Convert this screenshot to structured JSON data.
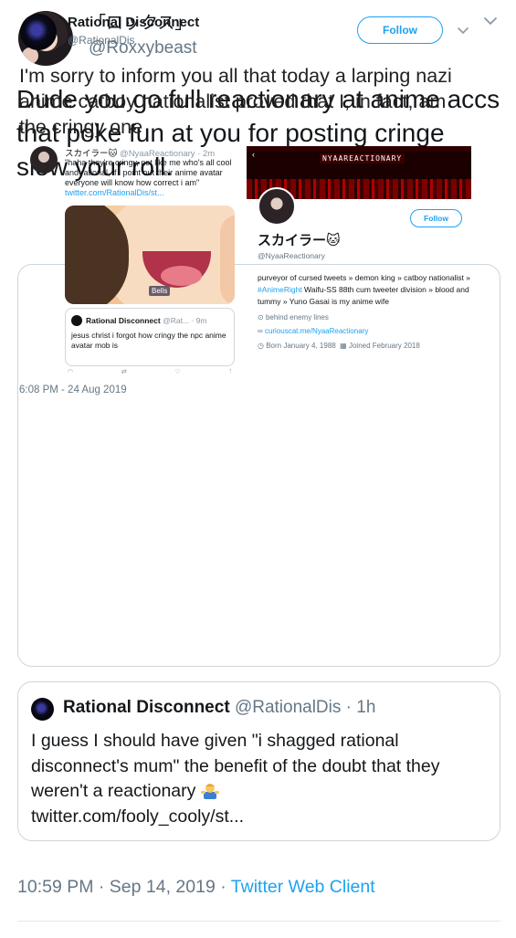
{
  "author": {
    "display_name": "「ロックス」",
    "handle": "@Roxxybeast"
  },
  "tweet": {
    "text": "Dude you go full reactionary at anime accs that poke fun at you for posting cringe slow your roll."
  },
  "quoted_screenshot": {
    "name": "Rational Disconnect",
    "handle": "@RationalDis",
    "follow_label": "Follow",
    "text": "I'm sorry to inform you all that today a larping nazi anime catboy nationalist proved that I, in fact, am the cringy one",
    "timestamp": "6:08 PM - 24 Aug 2019",
    "inner_tweet": {
      "name": "スカイラー🐱",
      "handle_time": "@NyaaReactionary · 2m",
      "text": "\"haha they're cringy, not like me who's all cool and rational, if i point out their anime avatar everyone will know how correct i am\"",
      "link": "twitter.com/RationalDis/st...",
      "image_badge": "Bells",
      "nested": {
        "name": "Rational Disconnect",
        "handle_time": "@Rat... · 9m",
        "text": "jesus christ i forgot how cringy the npc anime avatar mob is"
      }
    },
    "profile": {
      "banner_title": "NYAAREACTIONARY",
      "follow_label": "Follow",
      "name": "スカイラー🐱",
      "handle": "@NyaaReactionary",
      "bio_1": "purveyor of cursed tweets » demon king » catboy nationalist » ",
      "bio_hashtag": "#AnimeRight",
      "bio_2": " Waifu-SS 88th cum tweeter division » blood and tummy » Yuno Gasai is my anime wife",
      "location": "behind enemy lines",
      "website": "curiouscat.me/NyaaReactionary",
      "born": "Born January 4, 1988",
      "joined": "Joined February 2018"
    }
  },
  "quoted_tweet": {
    "name": "Rational Disconnect",
    "handle_time": "@RationalDis · 1h",
    "text": "I guess I should have given \"i shagged rational disconnect's mum\" the benefit of the doubt that they weren't a reactionary",
    "link": "twitter.com/fooly_cooly/st..."
  },
  "footer": {
    "time": "10:59 PM · Sep 14, 2019 · ",
    "client": "Twitter Web Client"
  }
}
